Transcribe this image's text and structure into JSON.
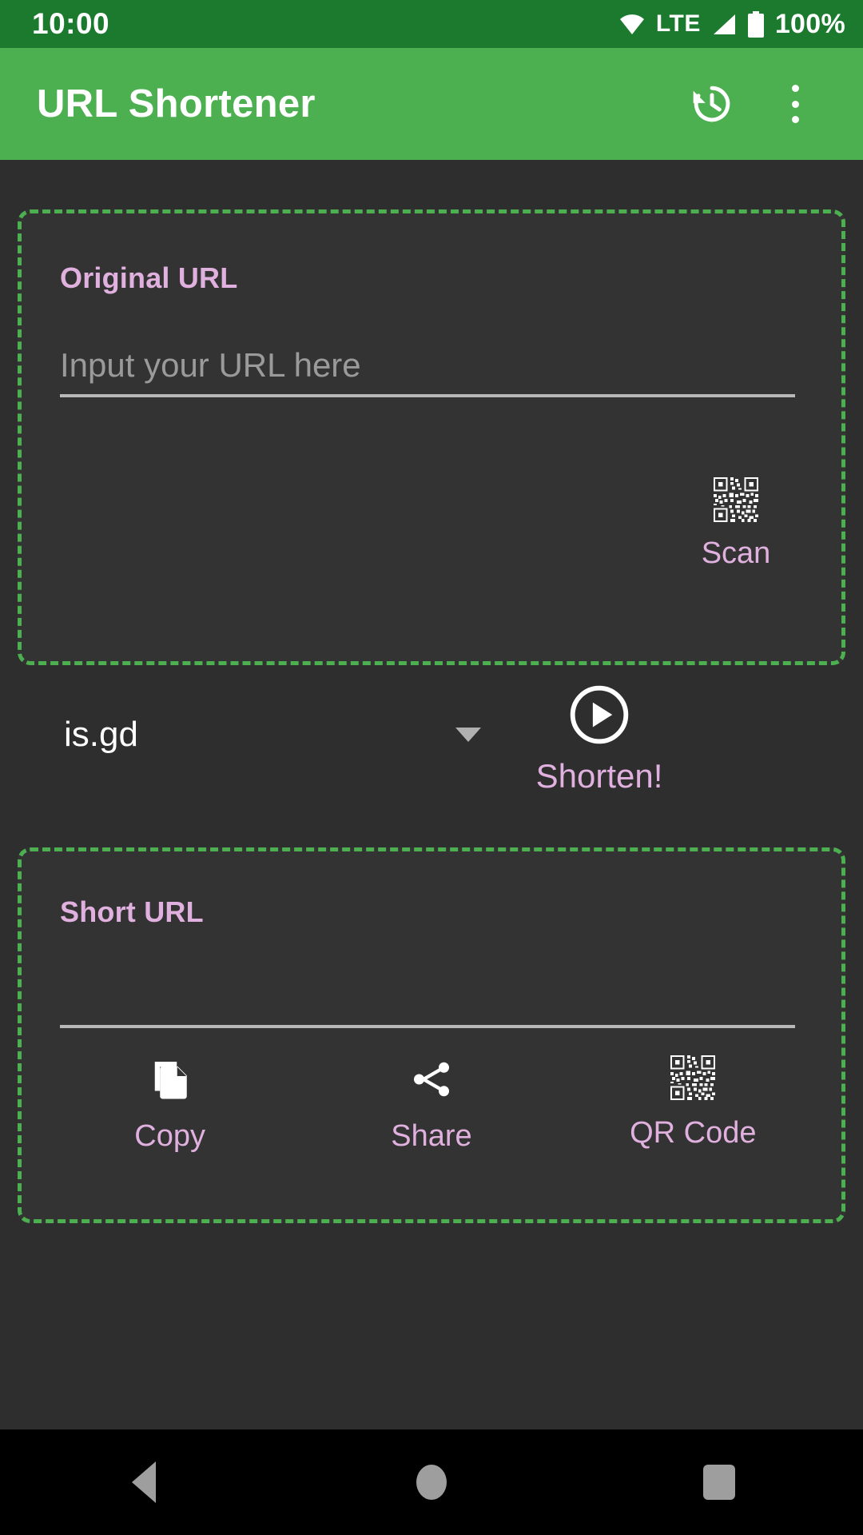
{
  "status_bar": {
    "time": "10:00",
    "network_type": "LTE",
    "battery_percent": "100%",
    "icons": [
      "wifi-icon",
      "signal-icon",
      "battery-icon"
    ],
    "background_color": "#1b7a2e"
  },
  "app_bar": {
    "title": "URL Shortener",
    "background_color": "#4caf50",
    "actions": [
      {
        "name": "history-icon",
        "label": "History"
      },
      {
        "name": "overflow-menu-icon",
        "label": "More options"
      }
    ]
  },
  "theme": {
    "background": "#2e2e2e",
    "card_background": "#333333",
    "accent_green": "#4caf50",
    "accent_pink": "#e0b0de",
    "text_primary": "#ffffff",
    "text_hint": "#9a9a9a"
  },
  "original_card": {
    "label": "Original URL",
    "input": {
      "value": "",
      "placeholder": "Input your URL here"
    },
    "scan_button": {
      "label": "Scan",
      "icon": "qr-code-icon"
    }
  },
  "shortener_row": {
    "service": {
      "selected": "is.gd",
      "icon": "chevron-down-icon"
    },
    "shorten_button": {
      "label": "Shorten!",
      "icon": "play-circle-icon"
    }
  },
  "short_card": {
    "label": "Short URL",
    "input": {
      "value": "",
      "placeholder": ""
    },
    "actions": [
      {
        "label": "Copy",
        "icon": "copy-icon"
      },
      {
        "label": "Share",
        "icon": "share-icon"
      },
      {
        "label": "QR Code",
        "icon": "qr-code-icon"
      }
    ]
  },
  "nav_bar": {
    "buttons": [
      {
        "name": "back-button",
        "icon": "triangle-left-icon"
      },
      {
        "name": "home-button",
        "icon": "circle-icon"
      },
      {
        "name": "recents-button",
        "icon": "square-icon"
      }
    ],
    "background_color": "#000000"
  }
}
